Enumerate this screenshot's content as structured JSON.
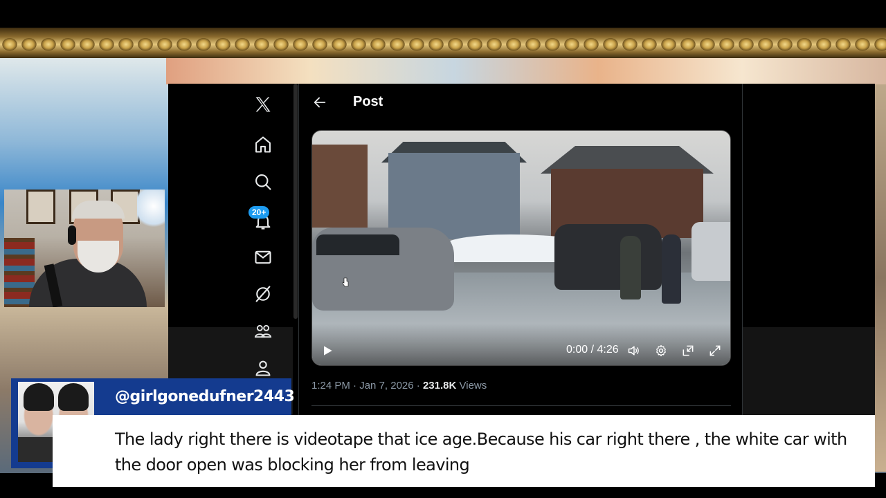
{
  "x_app": {
    "nav": {
      "notifications_badge": "20+"
    },
    "header": {
      "title": "Post"
    },
    "video": {
      "time": "0:00 / 4:26"
    },
    "post_meta": {
      "time": "1:24 PM",
      "separator1": " · ",
      "date": "Jan 7, 2026",
      "separator2": " · ",
      "views_count": "231.8K",
      "views_label": " Views"
    }
  },
  "comment_overlay": {
    "username": "@girlgonedufner2443",
    "text": "The lady right there is videotape that ice age.Because his car right there , the white car with the door open was blocking her from leaving"
  },
  "colors": {
    "accent": "#1d9bf0",
    "name_bar": "#143b8f",
    "youtube_red": "#ff0000"
  },
  "icons": [
    "x-logo-icon",
    "home-icon",
    "search-icon",
    "bell-icon",
    "mail-icon",
    "grok-icon",
    "communities-icon",
    "profile-icon",
    "back-arrow-icon",
    "play-icon",
    "volume-icon",
    "settings-icon",
    "pip-icon",
    "fullscreen-icon",
    "youtube-icon"
  ]
}
